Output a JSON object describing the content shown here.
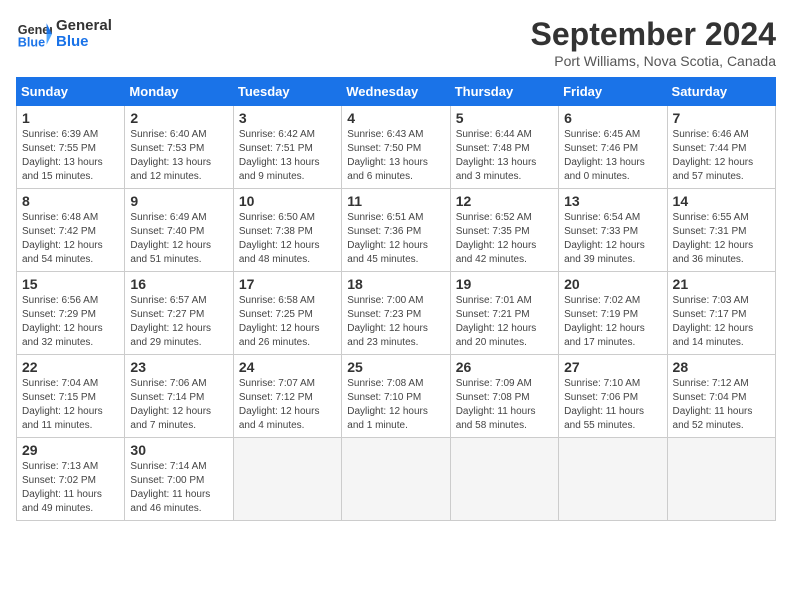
{
  "header": {
    "logo_line1": "General",
    "logo_line2": "Blue",
    "month": "September 2024",
    "location": "Port Williams, Nova Scotia, Canada"
  },
  "days_of_week": [
    "Sunday",
    "Monday",
    "Tuesday",
    "Wednesday",
    "Thursday",
    "Friday",
    "Saturday"
  ],
  "weeks": [
    [
      {
        "day": "1",
        "rise": "6:39 AM",
        "set": "7:55 PM",
        "daylight": "13 hours and 15 minutes."
      },
      {
        "day": "2",
        "rise": "6:40 AM",
        "set": "7:53 PM",
        "daylight": "13 hours and 12 minutes."
      },
      {
        "day": "3",
        "rise": "6:42 AM",
        "set": "7:51 PM",
        "daylight": "13 hours and 9 minutes."
      },
      {
        "day": "4",
        "rise": "6:43 AM",
        "set": "7:50 PM",
        "daylight": "13 hours and 6 minutes."
      },
      {
        "day": "5",
        "rise": "6:44 AM",
        "set": "7:48 PM",
        "daylight": "13 hours and 3 minutes."
      },
      {
        "day": "6",
        "rise": "6:45 AM",
        "set": "7:46 PM",
        "daylight": "13 hours and 0 minutes."
      },
      {
        "day": "7",
        "rise": "6:46 AM",
        "set": "7:44 PM",
        "daylight": "12 hours and 57 minutes."
      }
    ],
    [
      {
        "day": "8",
        "rise": "6:48 AM",
        "set": "7:42 PM",
        "daylight": "12 hours and 54 minutes."
      },
      {
        "day": "9",
        "rise": "6:49 AM",
        "set": "7:40 PM",
        "daylight": "12 hours and 51 minutes."
      },
      {
        "day": "10",
        "rise": "6:50 AM",
        "set": "7:38 PM",
        "daylight": "12 hours and 48 minutes."
      },
      {
        "day": "11",
        "rise": "6:51 AM",
        "set": "7:36 PM",
        "daylight": "12 hours and 45 minutes."
      },
      {
        "day": "12",
        "rise": "6:52 AM",
        "set": "7:35 PM",
        "daylight": "12 hours and 42 minutes."
      },
      {
        "day": "13",
        "rise": "6:54 AM",
        "set": "7:33 PM",
        "daylight": "12 hours and 39 minutes."
      },
      {
        "day": "14",
        "rise": "6:55 AM",
        "set": "7:31 PM",
        "daylight": "12 hours and 36 minutes."
      }
    ],
    [
      {
        "day": "15",
        "rise": "6:56 AM",
        "set": "7:29 PM",
        "daylight": "12 hours and 32 minutes."
      },
      {
        "day": "16",
        "rise": "6:57 AM",
        "set": "7:27 PM",
        "daylight": "12 hours and 29 minutes."
      },
      {
        "day": "17",
        "rise": "6:58 AM",
        "set": "7:25 PM",
        "daylight": "12 hours and 26 minutes."
      },
      {
        "day": "18",
        "rise": "7:00 AM",
        "set": "7:23 PM",
        "daylight": "12 hours and 23 minutes."
      },
      {
        "day": "19",
        "rise": "7:01 AM",
        "set": "7:21 PM",
        "daylight": "12 hours and 20 minutes."
      },
      {
        "day": "20",
        "rise": "7:02 AM",
        "set": "7:19 PM",
        "daylight": "12 hours and 17 minutes."
      },
      {
        "day": "21",
        "rise": "7:03 AM",
        "set": "7:17 PM",
        "daylight": "12 hours and 14 minutes."
      }
    ],
    [
      {
        "day": "22",
        "rise": "7:04 AM",
        "set": "7:15 PM",
        "daylight": "12 hours and 11 minutes."
      },
      {
        "day": "23",
        "rise": "7:06 AM",
        "set": "7:14 PM",
        "daylight": "12 hours and 7 minutes."
      },
      {
        "day": "24",
        "rise": "7:07 AM",
        "set": "7:12 PM",
        "daylight": "12 hours and 4 minutes."
      },
      {
        "day": "25",
        "rise": "7:08 AM",
        "set": "7:10 PM",
        "daylight": "12 hours and 1 minute."
      },
      {
        "day": "26",
        "rise": "7:09 AM",
        "set": "7:08 PM",
        "daylight": "11 hours and 58 minutes."
      },
      {
        "day": "27",
        "rise": "7:10 AM",
        "set": "7:06 PM",
        "daylight": "11 hours and 55 minutes."
      },
      {
        "day": "28",
        "rise": "7:12 AM",
        "set": "7:04 PM",
        "daylight": "11 hours and 52 minutes."
      }
    ],
    [
      {
        "day": "29",
        "rise": "7:13 AM",
        "set": "7:02 PM",
        "daylight": "11 hours and 49 minutes."
      },
      {
        "day": "30",
        "rise": "7:14 AM",
        "set": "7:00 PM",
        "daylight": "11 hours and 46 minutes."
      },
      null,
      null,
      null,
      null,
      null
    ]
  ]
}
